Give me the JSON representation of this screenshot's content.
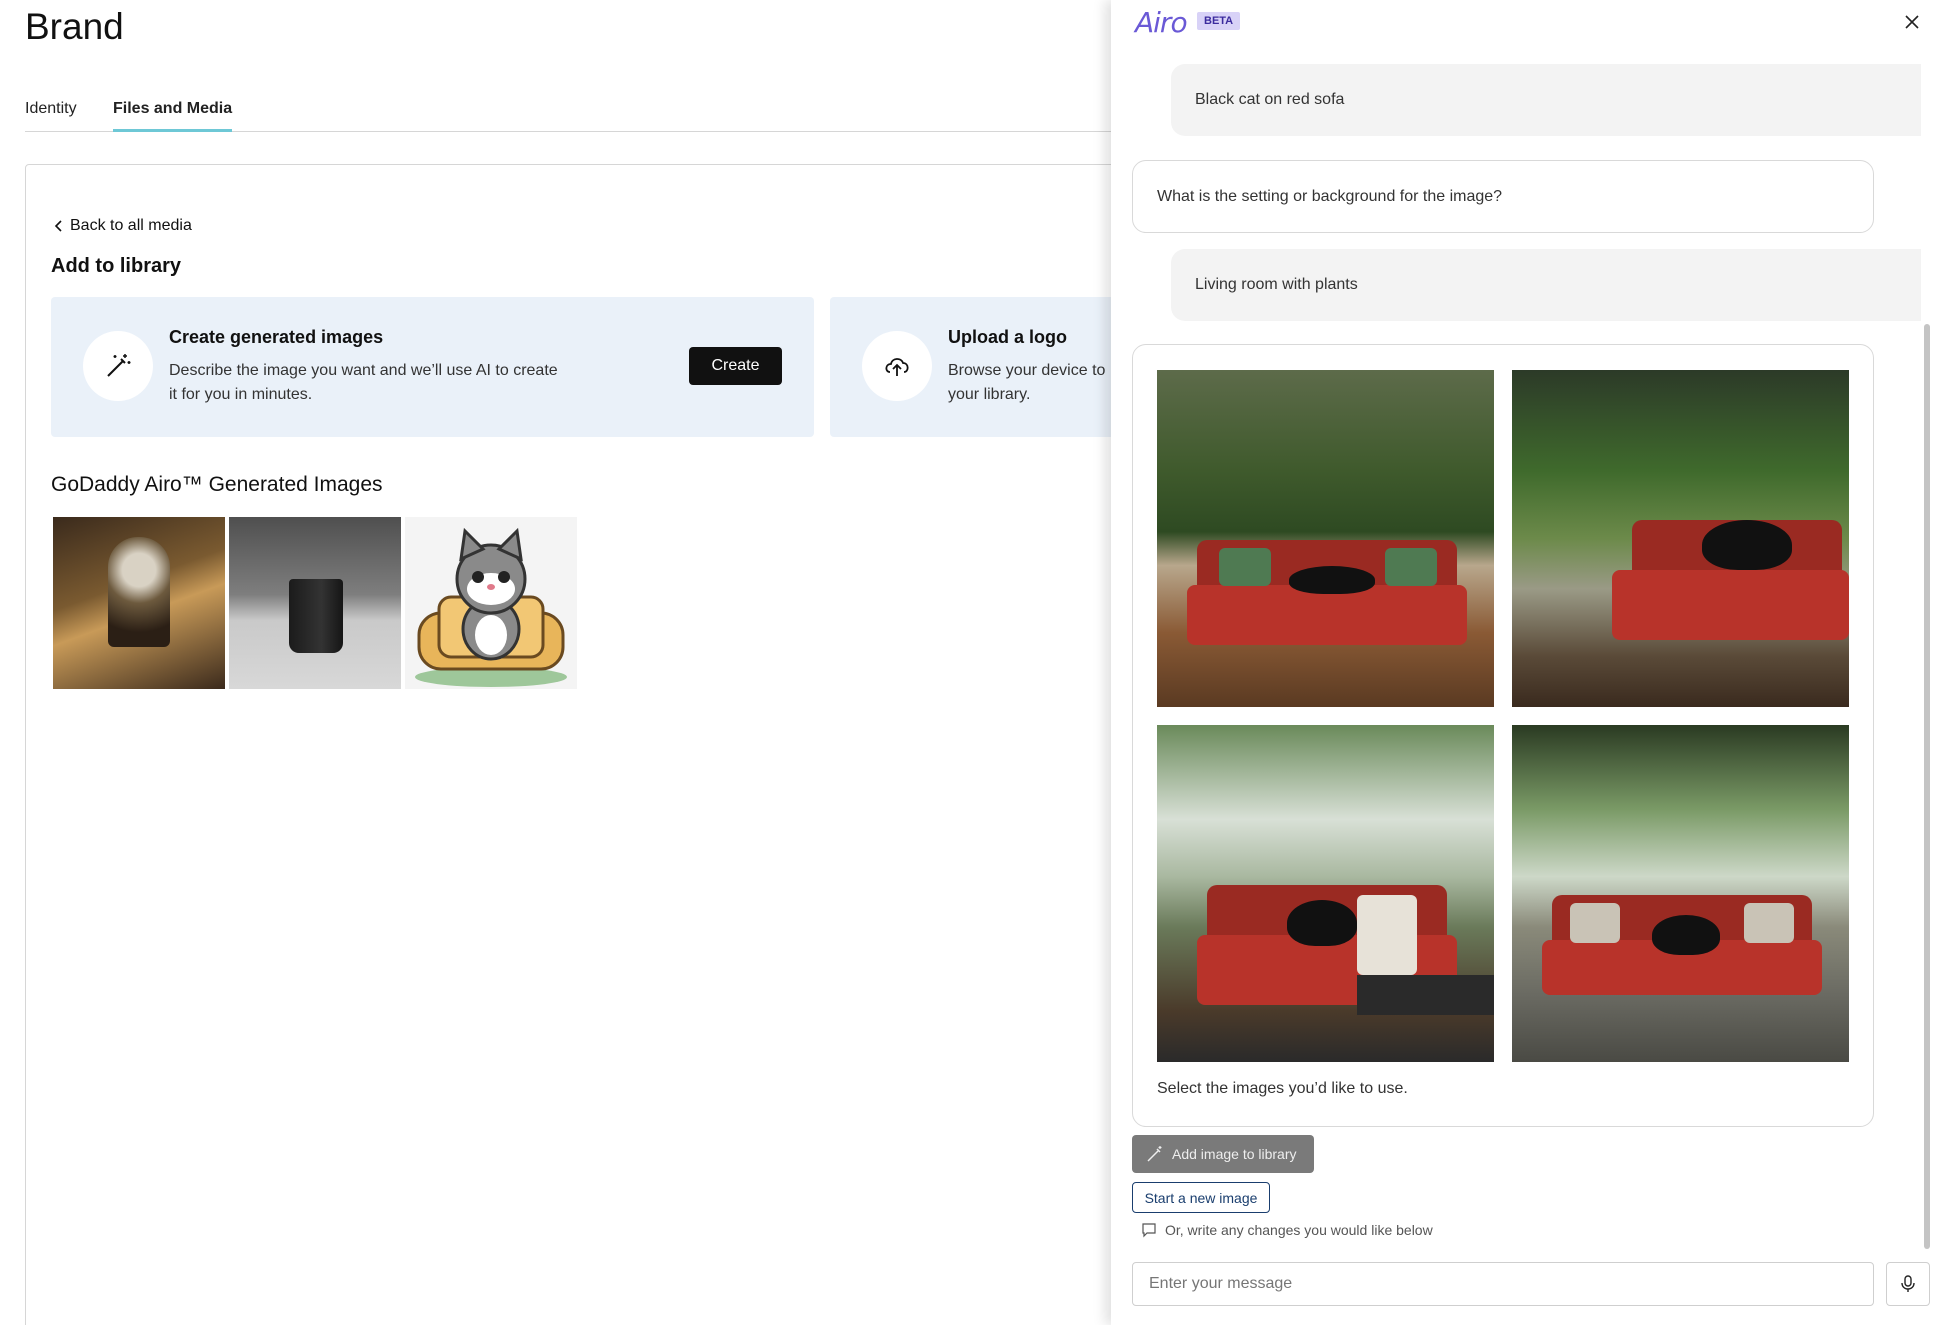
{
  "page": {
    "title": "Brand",
    "tabs": [
      {
        "label": "Identity"
      },
      {
        "label": "Files and Media",
        "active": true
      }
    ]
  },
  "library": {
    "back_label": "Back to all media",
    "section_title": "Add to library",
    "create_card": {
      "title": "Create generated images",
      "description": "Describe the image you want and we’ll use AI to create it for you in minutes.",
      "button_label": "Create",
      "icon": "magic-wand-icon"
    },
    "upload_card": {
      "title": "Upload a logo",
      "description": "Browse your device to your library.",
      "icon": "cloud-upload-icon"
    },
    "generated_title": "GoDaddy Airo™ Generated Images"
  },
  "airo": {
    "logo_text": "Airo",
    "badge": "BETA",
    "colors": {
      "accent": "#6a59d6",
      "badge_bg": "#d8d2f7"
    },
    "messages": [
      {
        "role": "user",
        "text": "Black cat on red sofa"
      },
      {
        "role": "assistant",
        "text": "What is the setting or background for the image?"
      },
      {
        "role": "user",
        "text": "Living room with plants"
      }
    ],
    "select_prompt": "Select the images you’d like to use.",
    "add_button_label": "Add image to library",
    "new_image_label": "Start a new image",
    "hint_text": "Or, write any changes you would like below",
    "input_placeholder": "Enter your message"
  }
}
